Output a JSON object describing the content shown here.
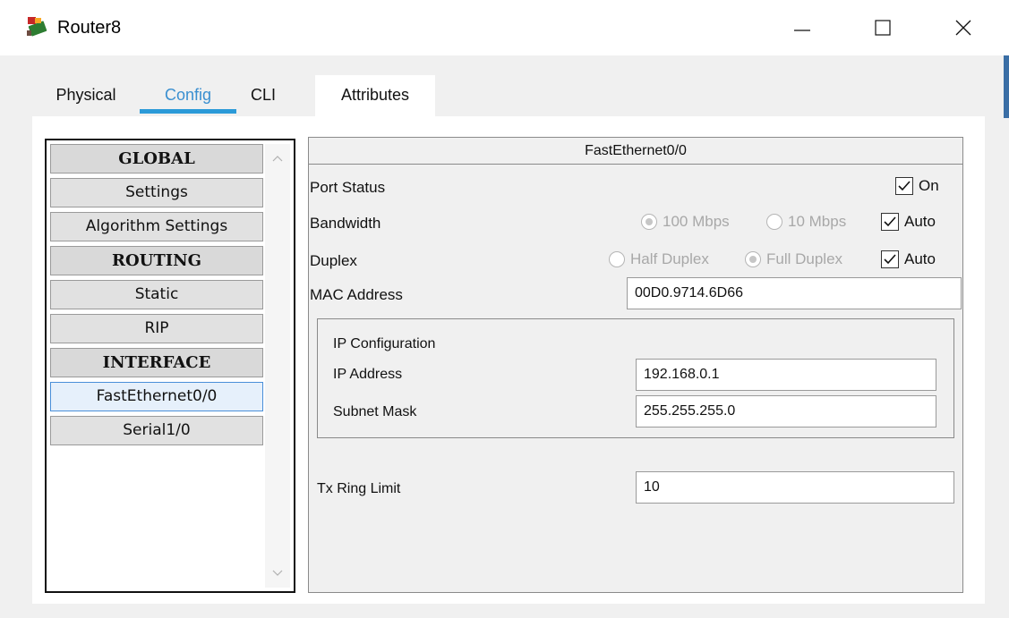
{
  "window": {
    "title": "Router8",
    "icon": "router-icon",
    "controls": {
      "minimize": "minimize-icon",
      "maximize": "maximize-icon",
      "close": "close-icon"
    }
  },
  "tabs": [
    {
      "label": "Physical"
    },
    {
      "label": "Config",
      "active": true
    },
    {
      "label": "CLI"
    },
    {
      "label": "Attributes"
    }
  ],
  "nav": {
    "items": [
      {
        "label": "GLOBAL",
        "kind": "header"
      },
      {
        "label": "Settings"
      },
      {
        "label": "Algorithm Settings"
      },
      {
        "label": "ROUTING",
        "kind": "header"
      },
      {
        "label": "Static"
      },
      {
        "label": "RIP"
      },
      {
        "label": "INTERFACE",
        "kind": "header"
      },
      {
        "label": "FastEthernet0/0",
        "selected": true
      },
      {
        "label": "Serial1/0"
      }
    ]
  },
  "detail": {
    "title": "FastEthernet0/0",
    "port_status": {
      "label": "Port Status",
      "on_label": "On",
      "on_checked": true
    },
    "bandwidth": {
      "label": "Bandwidth",
      "option1": "100 Mbps",
      "option2": "10 Mbps",
      "auto_label": "Auto",
      "selected": "100 Mbps",
      "auto_checked": true
    },
    "duplex": {
      "label": "Duplex",
      "option1": "Half Duplex",
      "option2": "Full Duplex",
      "auto_label": "Auto",
      "selected": "Full Duplex",
      "auto_checked": true
    },
    "mac": {
      "label": "MAC Address",
      "value": "00D0.9714.6D66"
    },
    "ip_config": {
      "title": "IP Configuration",
      "ip_label": "IP Address",
      "ip_value": "192.168.0.1",
      "mask_label": "Subnet Mask",
      "mask_value": "255.255.255.0"
    },
    "tx_ring": {
      "label": "Tx Ring Limit",
      "value": "10"
    }
  },
  "colors": {
    "accent": "#2b9ad8",
    "selected_border": "#4a8fd9"
  }
}
